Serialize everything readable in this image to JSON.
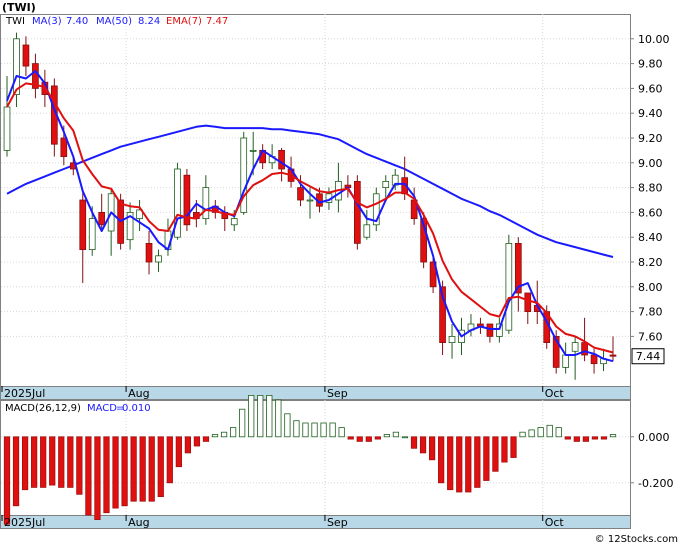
{
  "chart_data": [
    {
      "type": "candlestick",
      "title": "(TWI)",
      "legend": [
        {
          "label": "TWI",
          "value": "",
          "color": "#000000"
        },
        {
          "label": "MA(3)",
          "value": "7.40",
          "color": "#1a1aff"
        },
        {
          "label": "MA(50)",
          "value": "8.24",
          "color": "#1a1aff"
        },
        {
          "label": "EMA(7)",
          "value": "7.47",
          "color": "#e01010"
        }
      ],
      "ylim": [
        7.2,
        10.2
      ],
      "yticks": [
        "10.00",
        "9.80",
        "9.60",
        "9.40",
        "9.20",
        "9.00",
        "8.80",
        "8.60",
        "8.40",
        "8.20",
        "8.00",
        "7.80",
        "7.60"
      ],
      "ytick_values": [
        10.0,
        9.8,
        9.6,
        9.4,
        9.2,
        9.0,
        8.8,
        8.6,
        8.4,
        8.2,
        8.0,
        7.8,
        7.6
      ],
      "last_price": "7.44",
      "last_price_value": 7.44,
      "x_labels": [
        {
          "text": "2025Jul",
          "index": 0
        },
        {
          "text": "Aug",
          "index": 13
        },
        {
          "text": "Sep",
          "index": 34
        },
        {
          "text": "Oct",
          "index": 57
        }
      ],
      "colors": {
        "up": "#ffffff",
        "up_edge": "#1f5f1f",
        "down": "#e01010",
        "ma3": "#1a1aff",
        "ma50": "#1a1aff",
        "ema7": "#e01010"
      },
      "candles": [
        [
          9.1,
          9.45,
          9.7,
          9.05
        ],
        [
          9.55,
          10.0,
          10.05,
          9.45
        ],
        [
          9.95,
          9.78,
          10.02,
          9.7
        ],
        [
          9.8,
          9.6,
          9.88,
          9.52
        ],
        [
          9.65,
          9.55,
          9.75,
          9.45
        ],
        [
          9.62,
          9.15,
          9.68,
          9.05
        ],
        [
          9.2,
          9.05,
          9.3,
          8.98
        ],
        [
          9.0,
          8.95,
          9.05,
          8.9
        ],
        [
          8.7,
          8.3,
          8.78,
          8.03
        ],
        [
          8.3,
          8.55,
          8.65,
          8.25
        ],
        [
          8.6,
          8.5,
          8.75,
          8.45
        ],
        [
          8.45,
          8.75,
          8.8,
          8.25
        ],
        [
          8.7,
          8.35,
          8.75,
          8.3
        ],
        [
          8.38,
          8.6,
          8.68,
          8.3
        ],
        [
          8.55,
          8.62,
          8.7,
          8.45
        ],
        [
          8.35,
          8.2,
          8.45,
          8.1
        ],
        [
          8.2,
          8.25,
          8.3,
          8.12
        ],
        [
          8.3,
          8.45,
          8.55,
          8.25
        ],
        [
          8.4,
          8.95,
          9.0,
          8.38
        ],
        [
          8.9,
          8.5,
          8.95,
          8.45
        ],
        [
          8.6,
          8.55,
          8.7,
          8.48
        ],
        [
          8.55,
          8.8,
          8.9,
          8.5
        ],
        [
          8.65,
          8.6,
          8.7,
          8.55
        ],
        [
          8.6,
          8.55,
          8.65,
          8.45
        ],
        [
          8.5,
          8.55,
          8.62,
          8.45
        ],
        [
          8.6,
          9.2,
          9.25,
          8.58
        ],
        [
          9.1,
          9.1,
          9.25,
          8.9
        ],
        [
          9.1,
          9.0,
          9.15,
          8.95
        ],
        [
          9.0,
          9.05,
          9.15,
          8.95
        ],
        [
          9.1,
          8.95,
          9.12,
          8.85
        ],
        [
          8.95,
          8.85,
          9.05,
          8.8
        ],
        [
          8.8,
          8.7,
          8.9,
          8.65
        ],
        [
          8.7,
          8.7,
          8.8,
          8.55
        ],
        [
          8.75,
          8.65,
          8.8,
          8.6
        ],
        [
          8.68,
          8.75,
          8.8,
          8.62
        ],
        [
          8.7,
          8.85,
          9.0,
          8.6
        ],
        [
          8.82,
          8.8,
          8.9,
          8.72
        ],
        [
          8.85,
          8.35,
          8.9,
          8.3
        ],
        [
          8.4,
          8.5,
          8.62,
          8.38
        ],
        [
          8.5,
          8.75,
          8.8,
          8.45
        ],
        [
          8.8,
          8.85,
          8.9,
          8.7
        ],
        [
          8.82,
          8.9,
          8.95,
          8.78
        ],
        [
          8.88,
          8.75,
          9.05,
          8.7
        ],
        [
          8.7,
          8.55,
          8.8,
          8.5
        ],
        [
          8.55,
          8.2,
          8.6,
          8.15
        ],
        [
          8.2,
          8.0,
          8.25,
          7.95
        ],
        [
          8.0,
          7.55,
          8.05,
          7.45
        ],
        [
          7.55,
          7.6,
          7.7,
          7.42
        ],
        [
          7.55,
          7.65,
          7.75,
          7.45
        ],
        [
          7.65,
          7.7,
          7.78,
          7.6
        ],
        [
          7.7,
          7.68,
          7.75,
          7.62
        ],
        [
          7.7,
          7.6,
          7.7,
          7.55
        ],
        [
          7.6,
          7.7,
          7.75,
          7.55
        ],
        [
          7.65,
          8.35,
          8.42,
          7.62
        ],
        [
          8.35,
          7.95,
          8.4,
          7.8
        ],
        [
          7.95,
          7.8,
          7.95,
          7.7
        ],
        [
          7.85,
          7.8,
          8.05,
          7.7
        ],
        [
          7.8,
          7.55,
          7.85,
          7.5
        ],
        [
          7.6,
          7.35,
          7.65,
          7.3
        ],
        [
          7.35,
          7.45,
          7.55,
          7.3
        ],
        [
          7.48,
          7.55,
          7.6,
          7.25
        ],
        [
          7.55,
          7.45,
          7.75,
          7.4
        ],
        [
          7.45,
          7.38,
          7.5,
          7.3
        ],
        [
          7.38,
          7.42,
          7.5,
          7.32
        ],
        [
          7.45,
          7.44,
          7.6,
          7.4
        ]
      ],
      "ma3": [
        9.5,
        9.7,
        9.68,
        9.74,
        9.64,
        9.43,
        9.25,
        9.05,
        8.77,
        8.6,
        8.45,
        8.6,
        8.53,
        8.57,
        8.52,
        8.47,
        8.36,
        8.3,
        8.55,
        8.57,
        8.67,
        8.62,
        8.65,
        8.6,
        8.57,
        8.77,
        8.95,
        9.1,
        9.05,
        9.0,
        8.95,
        8.83,
        8.75,
        8.68,
        8.7,
        8.75,
        8.8,
        8.67,
        8.55,
        8.53,
        8.7,
        8.83,
        8.83,
        8.73,
        8.5,
        8.25,
        7.92,
        7.72,
        7.6,
        7.65,
        7.68,
        7.66,
        7.66,
        7.88,
        8.0,
        8.03,
        7.85,
        7.72,
        7.57,
        7.45,
        7.45,
        7.48,
        7.46,
        7.42,
        7.4
      ],
      "ma50": [
        8.75,
        8.79,
        8.83,
        8.86,
        8.89,
        8.92,
        8.95,
        8.98,
        9.01,
        9.04,
        9.07,
        9.1,
        9.13,
        9.15,
        9.17,
        9.19,
        9.21,
        9.23,
        9.25,
        9.27,
        9.29,
        9.3,
        9.29,
        9.28,
        9.28,
        9.28,
        9.28,
        9.28,
        9.27,
        9.27,
        9.26,
        9.25,
        9.24,
        9.23,
        9.21,
        9.19,
        9.15,
        9.11,
        9.07,
        9.04,
        9.01,
        8.98,
        8.95,
        8.91,
        8.87,
        8.83,
        8.79,
        8.75,
        8.71,
        8.68,
        8.65,
        8.61,
        8.58,
        8.54,
        8.5,
        8.46,
        8.42,
        8.39,
        8.36,
        8.34,
        8.32,
        8.3,
        8.28,
        8.26,
        8.24
      ],
      "ema7": [
        9.45,
        9.59,
        9.64,
        9.63,
        9.61,
        9.49,
        9.36,
        9.26,
        9.02,
        8.91,
        8.81,
        8.79,
        8.67,
        8.65,
        8.64,
        8.53,
        8.46,
        8.45,
        8.58,
        8.56,
        8.55,
        8.62,
        8.61,
        8.59,
        8.58,
        8.73,
        8.82,
        8.86,
        8.91,
        8.92,
        8.9,
        8.85,
        8.81,
        8.77,
        8.76,
        8.78,
        8.79,
        8.68,
        8.64,
        8.67,
        8.71,
        8.76,
        8.76,
        8.71,
        8.58,
        8.43,
        8.21,
        8.06,
        7.96,
        7.9,
        7.84,
        7.78,
        7.76,
        7.91,
        7.92,
        7.89,
        7.87,
        7.79,
        7.68,
        7.62,
        7.6,
        7.56,
        7.51,
        7.49,
        7.47
      ]
    },
    {
      "type": "bar",
      "title": "MACD(26,12,9)",
      "legend": [
        {
          "label": "MACD",
          "value": "0.010",
          "color": "#1a1aff"
        }
      ],
      "ylim": [
        -0.34,
        0.16
      ],
      "yticks": [
        "0.000",
        "-0.200"
      ],
      "ytick_values": [
        0.0,
        -0.2
      ],
      "x_labels": [
        {
          "text": "2025Jul",
          "index": 0
        },
        {
          "text": "Aug",
          "index": 13
        },
        {
          "text": "Sep",
          "index": 34
        },
        {
          "text": "Oct",
          "index": 57
        }
      ],
      "colors": {
        "positive": "#1f5f1f",
        "negative": "#e01010"
      },
      "values": [
        -0.38,
        -0.3,
        -0.23,
        -0.22,
        -0.22,
        -0.21,
        -0.22,
        -0.22,
        -0.25,
        -0.34,
        -0.36,
        -0.33,
        -0.31,
        -0.3,
        -0.28,
        -0.28,
        -0.28,
        -0.26,
        -0.2,
        -0.13,
        -0.07,
        -0.04,
        -0.02,
        0.01,
        0.02,
        0.04,
        0.12,
        0.18,
        0.18,
        0.18,
        0.16,
        0.1,
        0.07,
        0.06,
        0.06,
        0.06,
        0.06,
        0.04,
        -0.01,
        -0.02,
        -0.02,
        -0.01,
        0.01,
        0.02,
        0.0,
        -0.05,
        -0.07,
        -0.1,
        -0.2,
        -0.23,
        -0.24,
        -0.24,
        -0.22,
        -0.19,
        -0.15,
        -0.11,
        -0.09,
        0.02,
        0.03,
        0.04,
        0.05,
        0.04,
        -0.01,
        -0.02,
        -0.02,
        -0.01,
        -0.01,
        0.01
      ]
    }
  ],
  "footer": {
    "text": "© 12Stocks.com"
  }
}
